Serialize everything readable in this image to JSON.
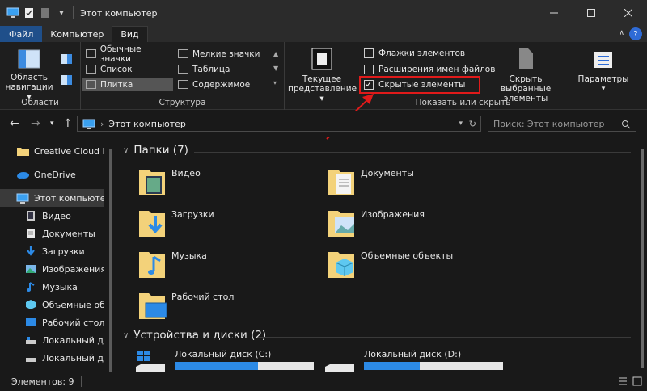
{
  "window": {
    "title": "Этот компьютер"
  },
  "ribbon_tabs": {
    "file": "Файл",
    "computer": "Компьютер",
    "view": "Вид"
  },
  "ribbon": {
    "nav_pane": {
      "label_line1": "Область",
      "label_line2": "навигации",
      "group": "Области"
    },
    "layout": {
      "group": "Структура",
      "items": [
        "Обычные значки",
        "Мелкие значки",
        "Список",
        "Таблица",
        "Плитка",
        "Содержимое"
      ]
    },
    "current_view": {
      "label_line1": "Текущее",
      "label_line2": "представление"
    },
    "show_hide": {
      "group": "Показать или скрыть",
      "item_checkboxes": "Флажки элементов",
      "file_extensions": "Расширения имен файлов",
      "hidden_items": "Скрытые элементы",
      "hide_selected_line1": "Скрыть выбранные",
      "hide_selected_line2": "элементы"
    },
    "options": {
      "label": "Параметры"
    }
  },
  "address": {
    "path": "Этот компьютер",
    "search_placeholder": "Поиск: Этот компьютер"
  },
  "nav_items": [
    "Creative Cloud Fil",
    "OneDrive",
    "Этот компьютер",
    "Видео",
    "Документы",
    "Загрузки",
    "Изображения",
    "Музыка",
    "Объемные объе",
    "Рабочий стол",
    "Локальный дис",
    "Локальный дис"
  ],
  "folders_section": {
    "title": "Папки (7)"
  },
  "folders": [
    "Видео",
    "Документы",
    "Загрузки",
    "Изображения",
    "Музыка",
    "Объемные объекты",
    "Рабочий стол"
  ],
  "drives_section": {
    "title": "Устройства и диски (2)"
  },
  "drives": [
    {
      "name": "Локальный диск (C:)",
      "used": 0.6
    },
    {
      "name": "Локальный диск (D:)",
      "used": 0.4
    }
  ],
  "status": {
    "items": "Элементов: 9"
  },
  "colors": {
    "accent": "#2c8ae6",
    "highlight": "#e01a1a",
    "folder": "#f3d27a"
  }
}
